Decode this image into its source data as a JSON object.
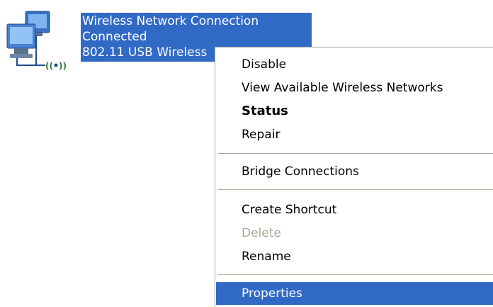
{
  "connection": {
    "name": "Wireless Network Connection",
    "status": "Connected",
    "device": "802.11 USB Wireless",
    "icon": "wireless-network-icon",
    "selection_color": "#316ac5"
  },
  "menu": {
    "items": [
      {
        "label": "Disable"
      },
      {
        "label": "View Available Wireless Networks"
      },
      {
        "label": "Status"
      },
      {
        "label": "Repair"
      },
      {
        "label": "Bridge Connections"
      },
      {
        "label": "Create Shortcut"
      },
      {
        "label": "Delete"
      },
      {
        "label": "Rename"
      },
      {
        "label": "Properties"
      }
    ]
  }
}
